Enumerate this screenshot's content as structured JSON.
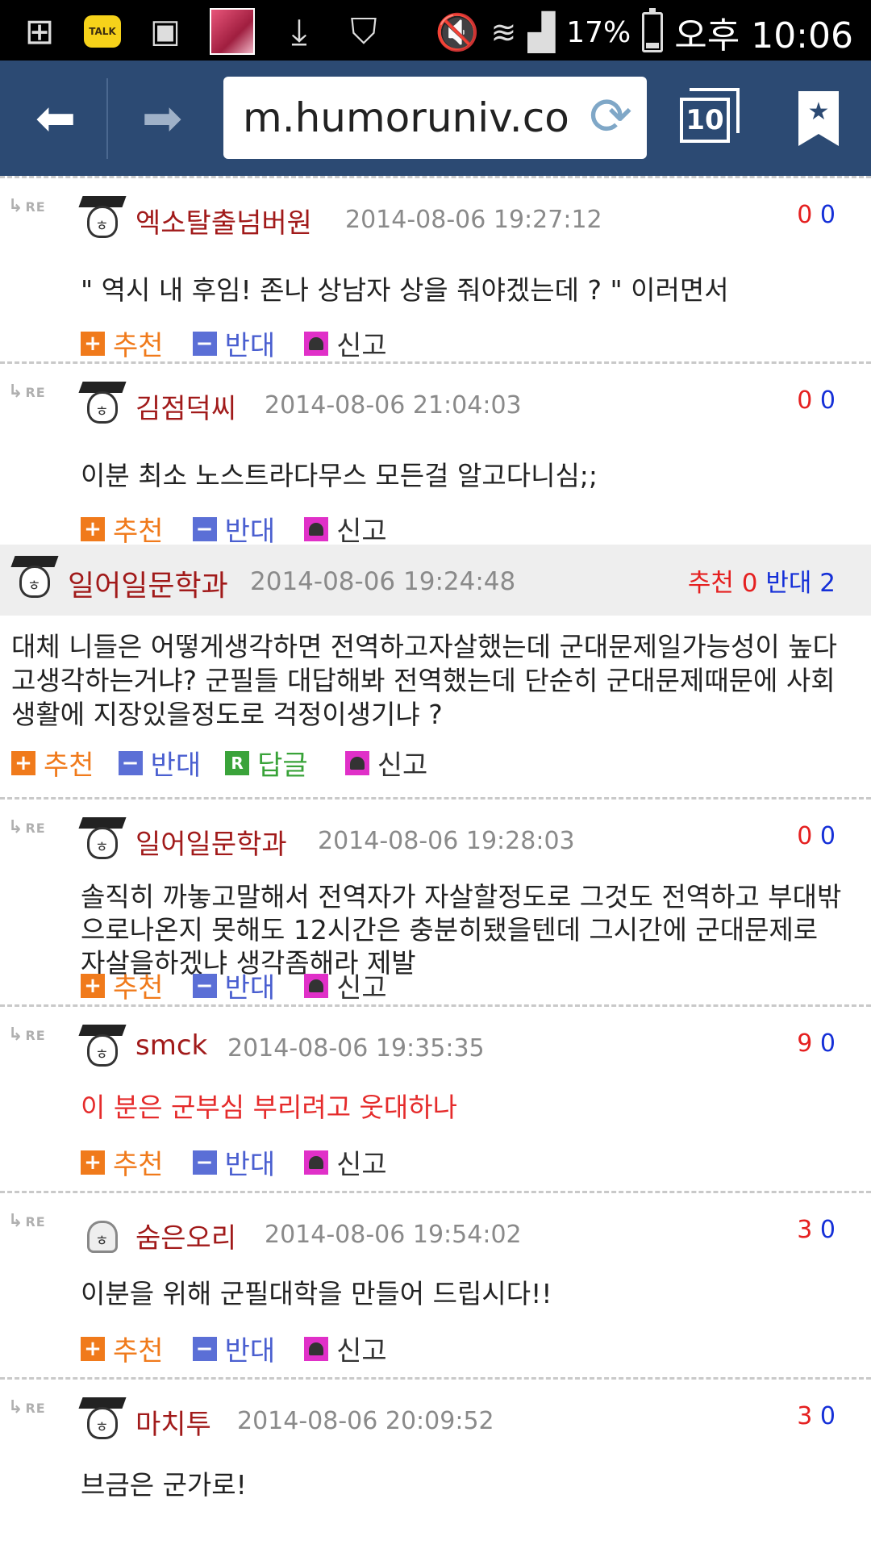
{
  "status_bar": {
    "battery": "17%",
    "time": "오후 10:06",
    "talk_badge": "TALK"
  },
  "browser": {
    "url": "m.humoruniv.co",
    "tab_count": "10"
  },
  "labels": {
    "up": "추천",
    "down": "반대",
    "reply": "답글",
    "report": "신고",
    "re": "RE"
  },
  "replies_top": [
    {
      "author": "엑소탈출넘버원",
      "date": "2014-08-06 19:27:12",
      "up": "0",
      "down": "0",
      "text": "\" 역시 내 후임! 존나 상남자 상을 줘야겠는데 ? \" 이러면서"
    },
    {
      "author": "김점덕씨",
      "date": "2014-08-06 21:04:03",
      "up": "0",
      "down": "0",
      "text": "이분 최소 노스트라다무스 모든걸 알고다니심;;"
    }
  ],
  "main_comment": {
    "author": "일어일문학과",
    "date": "2014-08-06 19:24:48",
    "up_label": "추천 0",
    "down_label": "반대 2",
    "text": "대체 니들은 어떻게생각하면 전역하고자살했는데 군대문제일가능성이 높다고생각하는거냐? 군필들 대답해봐 전역했는데 단순히 군대문제때문에 사회생활에 지장있을정도로 걱정이생기냐 ?"
  },
  "replies_bottom": [
    {
      "author": "일어일문학과",
      "date": "2014-08-06 19:28:03",
      "up": "0",
      "down": "0",
      "text": "솔직히 까놓고말해서 전역자가 자살할정도로 그것도 전역하고 부대밖으로나온지 못해도 12시간은 충분히됐을텐데 그시간에 군대문제로 자살을하겠냐 생각좀해라 제발"
    },
    {
      "author": "smck",
      "date": "2014-08-06 19:35:35",
      "up": "9",
      "down": "0",
      "text": "이 분은 군부심 부리려고 웃대하나"
    },
    {
      "author": "숨은오리",
      "date": "2014-08-06 19:54:02",
      "up": "3",
      "down": "0",
      "text": "이분을 위해 군필대학을 만들어 드립시다!!"
    },
    {
      "author": "마치투",
      "date": "2014-08-06 20:09:52",
      "up": "3",
      "down": "0",
      "text": "브금은 군가로!"
    }
  ]
}
